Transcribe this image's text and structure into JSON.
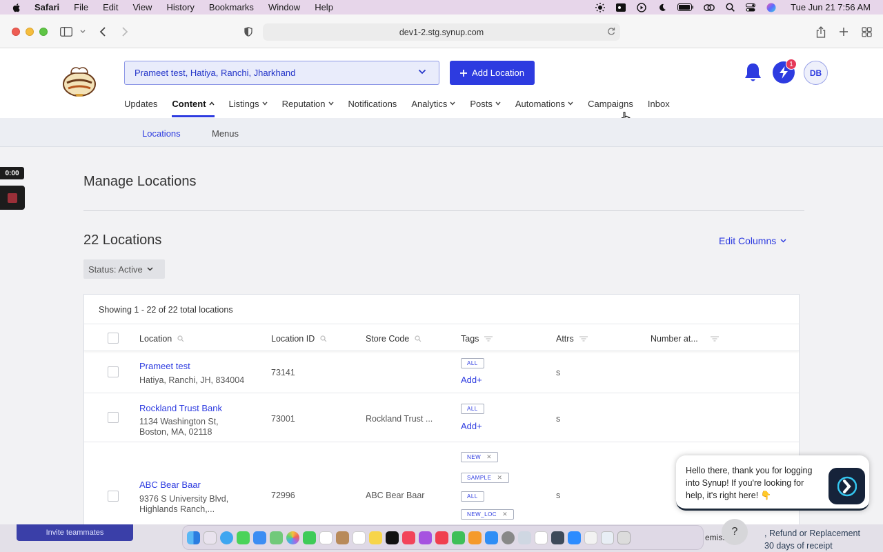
{
  "menubar": {
    "app": "Safari",
    "items": [
      "File",
      "Edit",
      "View",
      "History",
      "Bookmarks",
      "Window",
      "Help"
    ],
    "clock": "Tue Jun 21  7:56 AM"
  },
  "browser": {
    "url": "dev1-2.stg.synup.com"
  },
  "header": {
    "location_select": "Prameet test, Hatiya, Ranchi, Jharkhand",
    "add_location": "Add Location",
    "notification_badge": "1",
    "avatar_initials": "DB"
  },
  "nav": {
    "items": [
      {
        "label": "Updates",
        "caret": ""
      },
      {
        "label": "Content",
        "caret": "⌃"
      },
      {
        "label": "Listings",
        "caret": "⌄"
      },
      {
        "label": "Reputation",
        "caret": "⌄"
      },
      {
        "label": "Notifications",
        "caret": ""
      },
      {
        "label": "Analytics",
        "caret": "⌄"
      },
      {
        "label": "Posts",
        "caret": "⌄"
      },
      {
        "label": "Automations",
        "caret": "⌄"
      },
      {
        "label": "Campaigns",
        "caret": ""
      },
      {
        "label": "Inbox",
        "caret": ""
      }
    ]
  },
  "subnav": {
    "items": [
      "Locations",
      "Menus"
    ]
  },
  "recorder": {
    "timer": "0:00"
  },
  "main": {
    "title": "Manage Locations",
    "count_title": "22 Locations",
    "edit_columns": "Edit Columns",
    "status_filter": "Status: Active"
  },
  "table": {
    "showing": "Showing 1 - 22 of 22 total locations",
    "columns": [
      "Location",
      "Location ID",
      "Store Code",
      "Tags",
      "Attrs",
      "Number at..."
    ],
    "rows": [
      {
        "name": "Prameet test",
        "address_line1": "Hatiya, Ranchi, JH, 834004",
        "address_line2": "",
        "location_id": "73141",
        "store_code": "",
        "tags": [
          "ALL"
        ],
        "add_label": "Add+",
        "attrs": "s"
      },
      {
        "name": "Rockland Trust Bank",
        "address_line1": "1134 Washington St,",
        "address_line2": "Boston, MA, 02118",
        "location_id": "73001",
        "store_code": "Rockland Trust ...",
        "tags": [
          "ALL"
        ],
        "add_label": "Add+",
        "attrs": "s"
      },
      {
        "name": "ABC Bear Baar",
        "address_line1": "9376 S University Blvd,",
        "address_line2": "Highlands Ranch,...",
        "location_id": "72996",
        "store_code": "ABC Bear Baar",
        "tags": [
          "NEW",
          "SAMPLE",
          "ALL",
          "NEW_LOC"
        ],
        "attrs": "s"
      }
    ]
  },
  "chat": {
    "message": "Hello there, thank you for logging into Synup! If you're looking for help, it's right here! 👇"
  },
  "background": {
    "invite": "Invite teammates",
    "partial_text": "emiss",
    "refund_line1": ", Refund or Replacement",
    "refund_line2": "30 days of receipt"
  },
  "colors": {
    "accent": "#2d3be0",
    "menubar": "#e7d6ea",
    "page_bg": "#f2f2f4"
  }
}
